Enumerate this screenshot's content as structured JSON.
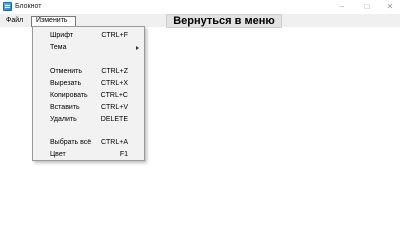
{
  "window": {
    "title": "Блокнот",
    "controls": {
      "minimize": "–",
      "maximize": "□",
      "close": "✕"
    }
  },
  "menubar": {
    "file_label": "Файл",
    "edit_label": "Изменить"
  },
  "back_button_label": "Вернуться в меню",
  "edit_menu": {
    "items": [
      {
        "label": "Шрифт",
        "shortcut": "CTRL+F"
      },
      {
        "label": "Тема",
        "shortcut": "",
        "submenu": true
      },
      {
        "label": "Отменить",
        "shortcut": "CTRL+Z"
      },
      {
        "label": "Вырезать",
        "shortcut": "CTRL+X"
      },
      {
        "label": "Копировать",
        "shortcut": "CTRL+C"
      },
      {
        "label": "Вставить",
        "shortcut": "CTRL+V"
      },
      {
        "label": "Удалить",
        "shortcut": "DELETE"
      },
      {
        "label": "Выбрать всё",
        "shortcut": "CTRL+A"
      },
      {
        "label": "Цвет",
        "shortcut": "F1"
      }
    ]
  }
}
